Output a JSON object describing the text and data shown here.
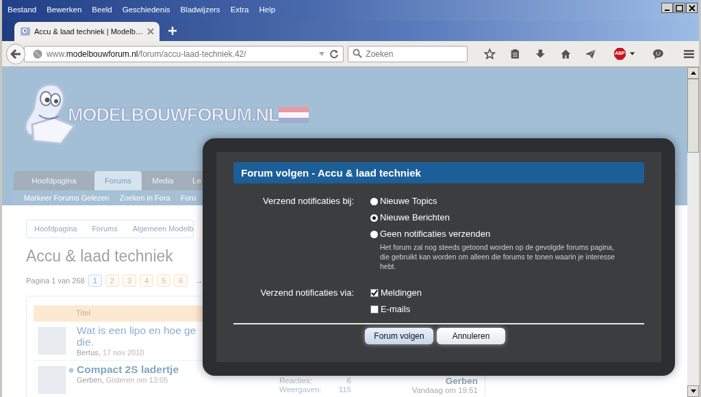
{
  "browser": {
    "menu": [
      "Bestand",
      "Bewerken",
      "Beeld",
      "Geschiedenis",
      "Bladwijzers",
      "Extra",
      "Help"
    ],
    "tab": {
      "title": "Accu & laad techniek | Modelb…",
      "selected": true
    },
    "url": {
      "prefix": "www.",
      "domain": "modelbouwforum.nl",
      "path": "/forum/accu-laad-techniek.42/"
    },
    "search": {
      "placeholder": "Zoeken"
    },
    "adblock_label": "ABP"
  },
  "site": {
    "logo_text": "MODELBOUWFORUM.NL",
    "nav_tabs": [
      {
        "label": "Hoofdpagina",
        "selected": false
      },
      {
        "label": "Forums",
        "selected": true
      },
      {
        "label": "Media",
        "selected": false
      },
      {
        "label": "Le",
        "selected": false
      }
    ],
    "subnav": [
      "Markeer Forums Gelezen",
      "Zoeken in Fora",
      "Foru"
    ],
    "breadcrumb": [
      "Hoofdpagina",
      "Forums",
      "Algemeen Modelb"
    ],
    "heading": "Accu & laad techniek",
    "pagination": {
      "summary": "Pagina 1 van 268",
      "pages": [
        {
          "label": "1",
          "selected": true
        },
        {
          "label": "2",
          "selected": false
        },
        {
          "label": "3",
          "selected": false
        },
        {
          "label": "4",
          "selected": false
        },
        {
          "label": "5",
          "selected": false
        },
        {
          "label": "6",
          "selected": false
        }
      ],
      "arrow": "→"
    },
    "threads": {
      "columns": [
        "Titel"
      ],
      "rows": [
        {
          "unread": false,
          "title_lines": [
            "Wat is een lipo en hoe ge",
            "die."
          ],
          "author": "Bertus,",
          "date": "17 nov 2010"
        },
        {
          "unread": true,
          "title_lines": [
            "Compact 2S ladertje"
          ],
          "author": "Gerben,",
          "date": "Gisteren om 13:05",
          "replies_label": "Reacties:",
          "replies": "6",
          "views_label": "Weergaven:",
          "views": "115",
          "last_author": "Gerben",
          "last_date": "Vandaag om 19:51"
        }
      ]
    }
  },
  "dialog": {
    "title": "Forum volgen - Accu & laad techniek",
    "groups": [
      {
        "label": "Verzend notificaties bij:",
        "kind": "radio",
        "options": [
          {
            "label": "Nieuwe Topics",
            "selected": false
          },
          {
            "label": "Nieuwe Berichten",
            "selected": true
          },
          {
            "label": "Geen notificaties verzenden",
            "selected": false,
            "hint": "Het forum zal nog steeds getoond worden op de gevolgde forums pagina, die gebruikt kan worden om alleen die forums te tonen waarin je interesse hebt."
          }
        ]
      },
      {
        "label": "Verzend notificaties via:",
        "kind": "checkbox",
        "options": [
          {
            "label": "Meldingen",
            "checked": true
          },
          {
            "label": "E-mails",
            "checked": false
          }
        ]
      }
    ],
    "buttons": [
      {
        "label": "Forum volgen",
        "primary": true
      },
      {
        "label": "Annuleren",
        "primary": false
      }
    ]
  }
}
